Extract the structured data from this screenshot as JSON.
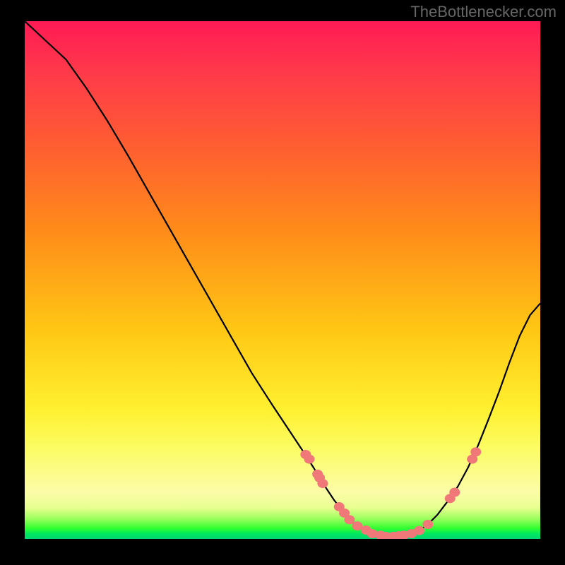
{
  "watermark": "TheBottlenecker.com",
  "chart_data": {
    "type": "line",
    "title": "",
    "xlabel": "",
    "ylabel": "",
    "xlim": [
      0,
      100
    ],
    "ylim": [
      0,
      100
    ],
    "curve": [
      {
        "x": 0.0,
        "y": 100.0
      },
      {
        "x": 4.0,
        "y": 96.3
      },
      {
        "x": 8.0,
        "y": 92.6
      },
      {
        "x": 12.0,
        "y": 87.0
      },
      {
        "x": 16.0,
        "y": 80.8
      },
      {
        "x": 20.0,
        "y": 74.1
      },
      {
        "x": 24.0,
        "y": 67.1
      },
      {
        "x": 28.0,
        "y": 60.1
      },
      {
        "x": 32.0,
        "y": 53.1
      },
      {
        "x": 36.0,
        "y": 46.1
      },
      {
        "x": 40.0,
        "y": 39.1
      },
      {
        "x": 44.0,
        "y": 32.1
      },
      {
        "x": 48.0,
        "y": 25.9
      },
      {
        "x": 51.0,
        "y": 21.4
      },
      {
        "x": 54.0,
        "y": 16.9
      },
      {
        "x": 56.0,
        "y": 13.8
      },
      {
        "x": 58.0,
        "y": 10.5
      },
      {
        "x": 60.0,
        "y": 7.5
      },
      {
        "x": 62.0,
        "y": 5.0
      },
      {
        "x": 64.0,
        "y": 2.8
      },
      {
        "x": 66.0,
        "y": 1.5
      },
      {
        "x": 68.0,
        "y": 0.8
      },
      {
        "x": 70.0,
        "y": 0.5
      },
      {
        "x": 72.0,
        "y": 0.5
      },
      {
        "x": 74.0,
        "y": 0.7
      },
      {
        "x": 76.0,
        "y": 1.3
      },
      {
        "x": 78.0,
        "y": 2.6
      },
      {
        "x": 80.0,
        "y": 4.6
      },
      {
        "x": 82.0,
        "y": 7.2
      },
      {
        "x": 84.0,
        "y": 10.1
      },
      {
        "x": 86.0,
        "y": 13.8
      },
      {
        "x": 88.0,
        "y": 18.2
      },
      {
        "x": 90.0,
        "y": 23.2
      },
      {
        "x": 92.0,
        "y": 28.4
      },
      {
        "x": 94.0,
        "y": 34.0
      },
      {
        "x": 96.0,
        "y": 39.2
      },
      {
        "x": 98.0,
        "y": 43.2
      },
      {
        "x": 100.0,
        "y": 45.5
      }
    ],
    "markers": [
      {
        "x": 54.5,
        "y": 16.3
      },
      {
        "x": 55.2,
        "y": 15.4
      },
      {
        "x": 56.8,
        "y": 12.5
      },
      {
        "x": 57.2,
        "y": 11.8
      },
      {
        "x": 57.8,
        "y": 10.7
      },
      {
        "x": 61.0,
        "y": 6.2
      },
      {
        "x": 62.0,
        "y": 5.0
      },
      {
        "x": 63.0,
        "y": 3.7
      },
      {
        "x": 64.5,
        "y": 2.5
      },
      {
        "x": 66.2,
        "y": 1.7
      },
      {
        "x": 67.4,
        "y": 1.0
      },
      {
        "x": 69.0,
        "y": 0.7
      },
      {
        "x": 70.0,
        "y": 0.5
      },
      {
        "x": 71.5,
        "y": 0.5
      },
      {
        "x": 72.5,
        "y": 0.6
      },
      {
        "x": 73.5,
        "y": 0.7
      },
      {
        "x": 75.0,
        "y": 1.0
      },
      {
        "x": 76.5,
        "y": 1.6
      },
      {
        "x": 78.2,
        "y": 2.8
      },
      {
        "x": 82.5,
        "y": 7.8
      },
      {
        "x": 83.4,
        "y": 9.0
      },
      {
        "x": 86.8,
        "y": 15.4
      },
      {
        "x": 87.5,
        "y": 16.8
      }
    ],
    "marker_color": "#f07878",
    "line_color": "#000000"
  }
}
